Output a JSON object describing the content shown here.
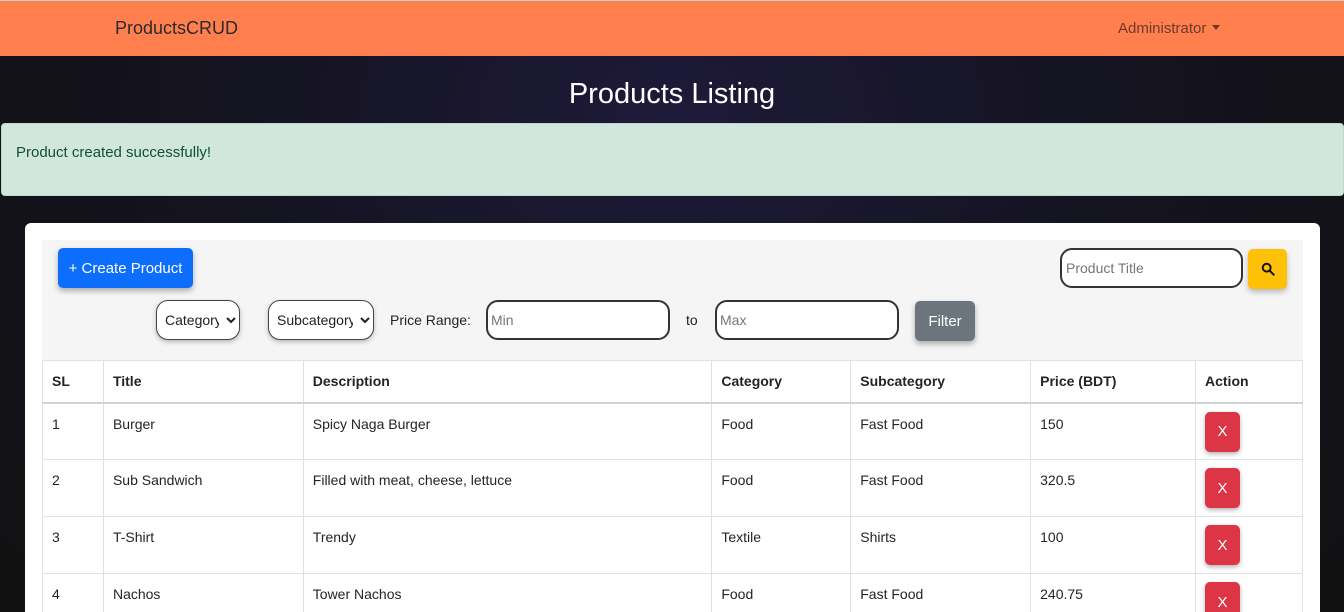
{
  "navbar": {
    "brand": "ProductsCRUD",
    "user_menu": "Administrator"
  },
  "page_title": "Products Listing",
  "alert": {
    "message": "Product created successfully!"
  },
  "toolbar": {
    "create_label": "+ Create Product",
    "search_placeholder": "Product Title",
    "search_icon": "search-icon",
    "category_select": "Category",
    "subcategory_select": "Subcategory",
    "price_range_label": "Price Range:",
    "min_placeholder": "Min",
    "to_label": "to",
    "max_placeholder": "Max",
    "filter_label": "Filter"
  },
  "table": {
    "headers": [
      "SL",
      "Title",
      "Description",
      "Category",
      "Subcategory",
      "Price (BDT)",
      "Action"
    ],
    "rows": [
      {
        "sl": "1",
        "title": "Burger",
        "description": "Spicy Naga Burger",
        "category": "Food",
        "subcategory": "Fast Food",
        "price": "150",
        "action": "X"
      },
      {
        "sl": "2",
        "title": "Sub Sandwich",
        "description": "Filled with meat, cheese, lettuce",
        "category": "Food",
        "subcategory": "Fast Food",
        "price": "320.5",
        "action": "X"
      },
      {
        "sl": "3",
        "title": "T-Shirt",
        "description": "Trendy",
        "category": "Textile",
        "subcategory": "Shirts",
        "price": "100",
        "action": "X"
      },
      {
        "sl": "4",
        "title": "Nachos",
        "description": "Tower Nachos",
        "category": "Food",
        "subcategory": "Fast Food",
        "price": "240.75",
        "action": "X"
      }
    ]
  },
  "colors": {
    "navbar": "#ff7f4f",
    "primary": "#0d6efd",
    "warning": "#ffc107",
    "danger": "#dc3545",
    "secondary": "#6c757d",
    "alert_bg": "#d1e7dd"
  }
}
